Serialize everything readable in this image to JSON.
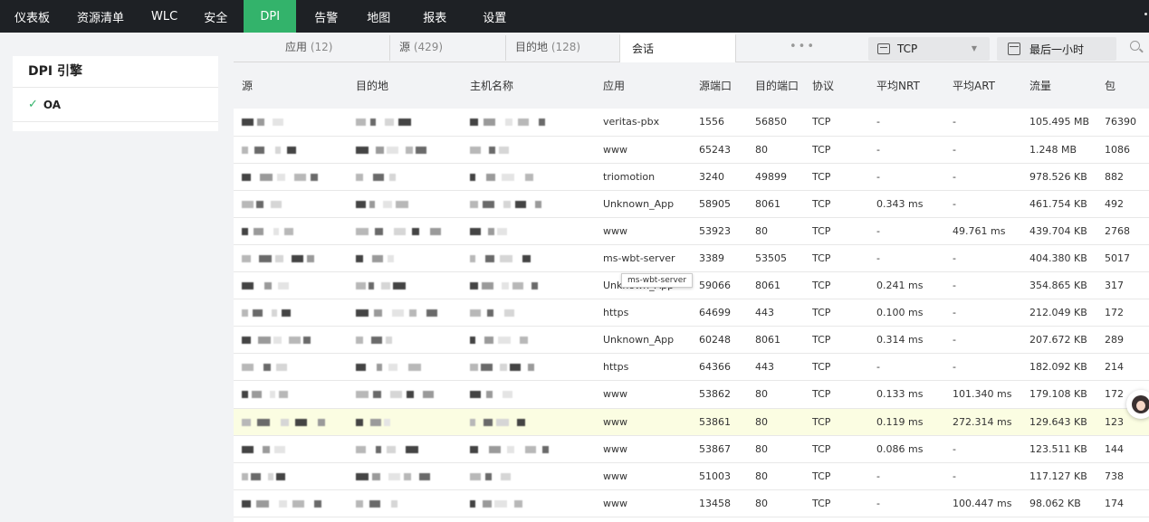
{
  "nav": {
    "items": [
      {
        "label": "仪表板"
      },
      {
        "label": "资源清单"
      },
      {
        "label": "WLC"
      },
      {
        "label": "安全"
      },
      {
        "label": "DPI"
      },
      {
        "label": "告警"
      },
      {
        "label": "地图"
      },
      {
        "label": "报表"
      },
      {
        "label": "设置"
      }
    ],
    "active": "DPI"
  },
  "left_panel": {
    "title": "DPI 引擎",
    "items": [
      {
        "label": "OA",
        "checked": true
      }
    ]
  },
  "tabs": [
    {
      "label": "应用",
      "count": "(12)"
    },
    {
      "label": "源",
      "count": "(429)"
    },
    {
      "label": "目的地",
      "count": "(128)"
    },
    {
      "label": "会话",
      "count": ""
    }
  ],
  "more_label": "•••",
  "protocol_select": {
    "value": "TCP"
  },
  "time_select": {
    "value": "最后一小时"
  },
  "table": {
    "headers": [
      "源",
      "目的地",
      "主机名称",
      "应用",
      "源端口",
      "目的端口",
      "协议",
      "平均NRT",
      "平均ART",
      "流量",
      "包"
    ],
    "rows": [
      [
        "veritas-pbx",
        "1556",
        "56850",
        "TCP",
        "-",
        "-",
        "105.495 MB",
        "76390"
      ],
      [
        "www",
        "65243",
        "80",
        "TCP",
        "-",
        "-",
        "1.248 MB",
        "1086"
      ],
      [
        "triomotion",
        "3240",
        "49899",
        "TCP",
        "-",
        "-",
        "978.526 KB",
        "882"
      ],
      [
        "Unknown_App",
        "58905",
        "8061",
        "TCP",
        "0.343 ms",
        "-",
        "461.754 KB",
        "492"
      ],
      [
        "www",
        "53923",
        "80",
        "TCP",
        "-",
        "49.761 ms",
        "439.704 KB",
        "2768"
      ],
      [
        "ms-wbt-server",
        "3389",
        "53505",
        "TCP",
        "-",
        "-",
        "404.380 KB",
        "5017"
      ],
      [
        "Unknown_App",
        "59066",
        "8061",
        "TCP",
        "0.241 ms",
        "-",
        "354.865 KB",
        "317"
      ],
      [
        "https",
        "64699",
        "443",
        "TCP",
        "0.100 ms",
        "-",
        "212.049 KB",
        "172"
      ],
      [
        "Unknown_App",
        "60248",
        "8061",
        "TCP",
        "0.314 ms",
        "-",
        "207.672 KB",
        "289"
      ],
      [
        "https",
        "64366",
        "443",
        "TCP",
        "-",
        "-",
        "182.092 KB",
        "214"
      ],
      [
        "www",
        "53862",
        "80",
        "TCP",
        "0.133 ms",
        "101.340 ms",
        "179.108 KB",
        "172"
      ],
      [
        "www",
        "53861",
        "80",
        "TCP",
        "0.119 ms",
        "272.314 ms",
        "129.643 KB",
        "123"
      ],
      [
        "www",
        "53867",
        "80",
        "TCP",
        "0.086 ms",
        "-",
        "123.511 KB",
        "144"
      ],
      [
        "www",
        "51003",
        "80",
        "TCP",
        "-",
        "-",
        "117.127 KB",
        "738"
      ],
      [
        "www",
        "13458",
        "80",
        "TCP",
        "-",
        "100.447 ms",
        "98.062 KB",
        "174"
      ]
    ],
    "highlighted_row": 11
  },
  "tooltip": "ms-wbt-server",
  "colors": {
    "accent": "#33b36b",
    "nav_bg": "#1e2125",
    "highlight": "#fbfde2"
  }
}
